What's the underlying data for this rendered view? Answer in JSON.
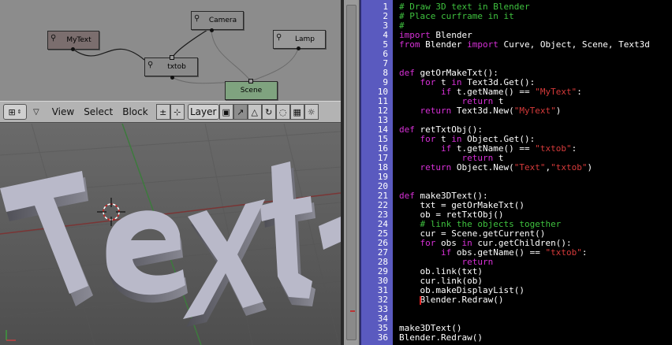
{
  "graph": {
    "nodes": [
      {
        "id": "camera",
        "label": "Camera",
        "glyph": "⚲",
        "fill": "#8e8e8e"
      },
      {
        "id": "mytext",
        "label": "MyText",
        "glyph": "⚲",
        "fill": "#7b6e6e"
      },
      {
        "id": "lamp",
        "label": "Lamp",
        "glyph": "⚲",
        "fill": "#9a9a9a"
      },
      {
        "id": "txtob",
        "label": "txtob",
        "glyph": "⚲",
        "fill": "#8a8a8a"
      },
      {
        "id": "scene",
        "label": "Scene",
        "glyph": "",
        "fill": "#7fa37f"
      }
    ]
  },
  "header": {
    "editor_type_glyph": "⊞",
    "menu": [
      "View",
      "Select",
      "Block"
    ],
    "layer_label": "Layer",
    "colors": {
      "background": "#b3b3b3"
    }
  },
  "viewport": {
    "text_object": "Text",
    "colors": {
      "text_face": "#b9b9c9",
      "background": "#5c5c5c",
      "grid_red": "#7a3535",
      "grid_green": "#3d7a3d"
    }
  },
  "editor": {
    "colors": {
      "comment": "#3fc23f",
      "keyword": "#d630d6",
      "string": "#d63a3a",
      "gutter": "#5a5abf",
      "bg": "#000000"
    },
    "cursor_line": 32,
    "lines": [
      {
        "n": "1",
        "tokens": [
          [
            "c",
            "# Draw 3D text in Blender"
          ]
        ]
      },
      {
        "n": "2",
        "tokens": [
          [
            "c",
            "# Place curframe in it"
          ]
        ]
      },
      {
        "n": "3",
        "tokens": [
          [
            "c",
            "#"
          ]
        ]
      },
      {
        "n": "4",
        "tokens": [
          [
            "k",
            "import"
          ],
          [
            "n",
            " Blender"
          ]
        ]
      },
      {
        "n": "5",
        "tokens": [
          [
            "k",
            "from"
          ],
          [
            "n",
            " Blender "
          ],
          [
            "k",
            "import"
          ],
          [
            "n",
            " Curve, Object, Scene, Text3d"
          ]
        ]
      },
      {
        "n": "6",
        "tokens": []
      },
      {
        "n": "7",
        "tokens": []
      },
      {
        "n": "8",
        "tokens": [
          [
            "k",
            "def"
          ],
          [
            "n",
            " getOrMakeTxt():"
          ]
        ]
      },
      {
        "n": "9",
        "tokens": [
          [
            "n",
            "    "
          ],
          [
            "k",
            "for"
          ],
          [
            "n",
            " t "
          ],
          [
            "k",
            "in"
          ],
          [
            "n",
            " Text3d.Get():"
          ]
        ]
      },
      {
        "n": "10",
        "tokens": [
          [
            "n",
            "        "
          ],
          [
            "k",
            "if"
          ],
          [
            "n",
            " t.getName() == "
          ],
          [
            "s",
            "\"MyText\""
          ],
          [
            "n",
            ":"
          ]
        ]
      },
      {
        "n": "11",
        "tokens": [
          [
            "n",
            "            "
          ],
          [
            "k",
            "return"
          ],
          [
            "n",
            " t"
          ]
        ]
      },
      {
        "n": "12",
        "tokens": [
          [
            "n",
            "    "
          ],
          [
            "k",
            "return"
          ],
          [
            "n",
            " Text3d.New("
          ],
          [
            "s",
            "\"MyText\""
          ],
          [
            "n",
            ")"
          ]
        ]
      },
      {
        "n": "13",
        "tokens": []
      },
      {
        "n": "14",
        "tokens": [
          [
            "k",
            "def"
          ],
          [
            "n",
            " retTxtObj():"
          ]
        ]
      },
      {
        "n": "15",
        "tokens": [
          [
            "n",
            "    "
          ],
          [
            "k",
            "for"
          ],
          [
            "n",
            " t "
          ],
          [
            "k",
            "in"
          ],
          [
            "n",
            " Object.Get():"
          ]
        ]
      },
      {
        "n": "16",
        "tokens": [
          [
            "n",
            "        "
          ],
          [
            "k",
            "if"
          ],
          [
            "n",
            " t.getName() == "
          ],
          [
            "s",
            "\"txtob\""
          ],
          [
            "n",
            ":"
          ]
        ]
      },
      {
        "n": "17",
        "tokens": [
          [
            "n",
            "            "
          ],
          [
            "k",
            "return"
          ],
          [
            "n",
            " t"
          ]
        ]
      },
      {
        "n": "18",
        "tokens": [
          [
            "n",
            "    "
          ],
          [
            "k",
            "return"
          ],
          [
            "n",
            " Object.New("
          ],
          [
            "s",
            "\"Text\""
          ],
          [
            "n",
            ","
          ],
          [
            "s",
            "\"txtob\""
          ],
          [
            "n",
            ")"
          ]
        ]
      },
      {
        "n": "19",
        "tokens": []
      },
      {
        "n": "20",
        "tokens": []
      },
      {
        "n": "21",
        "tokens": [
          [
            "k",
            "def"
          ],
          [
            "n",
            " make3DText():"
          ]
        ]
      },
      {
        "n": "22",
        "tokens": [
          [
            "n",
            "    txt = getOrMakeTxt()"
          ]
        ]
      },
      {
        "n": "23",
        "tokens": [
          [
            "n",
            "    ob = retTxtObj()"
          ]
        ]
      },
      {
        "n": "24",
        "tokens": [
          [
            "n",
            "    "
          ],
          [
            "c",
            "# link the objects together"
          ]
        ]
      },
      {
        "n": "25",
        "tokens": [
          [
            "n",
            "    cur = Scene.getCurrent()"
          ]
        ]
      },
      {
        "n": "26",
        "tokens": [
          [
            "n",
            "    "
          ],
          [
            "k",
            "for"
          ],
          [
            "n",
            " obs "
          ],
          [
            "k",
            "in"
          ],
          [
            "n",
            " cur.getChildren():"
          ]
        ]
      },
      {
        "n": "27",
        "tokens": [
          [
            "n",
            "        "
          ],
          [
            "k",
            "if"
          ],
          [
            "n",
            " obs.getName() == "
          ],
          [
            "s",
            "\"txtob\""
          ],
          [
            "n",
            ":"
          ]
        ]
      },
      {
        "n": "28",
        "tokens": [
          [
            "n",
            "            "
          ],
          [
            "k",
            "return"
          ]
        ]
      },
      {
        "n": "29",
        "tokens": [
          [
            "n",
            "    ob.link(txt)"
          ]
        ]
      },
      {
        "n": "30",
        "tokens": [
          [
            "n",
            "    cur.link(ob)"
          ]
        ]
      },
      {
        "n": "31",
        "tokens": [
          [
            "n",
            "    ob.makeDisplayList()"
          ]
        ]
      },
      {
        "n": "32",
        "tokens": [
          [
            "n",
            "    Blender.Redraw()"
          ]
        ]
      },
      {
        "n": "33",
        "tokens": []
      },
      {
        "n": "34",
        "tokens": []
      },
      {
        "n": "35",
        "tokens": [
          [
            "n",
            "make3DText()"
          ]
        ]
      },
      {
        "n": "36",
        "tokens": [
          [
            "n",
            "Blender.Redraw()"
          ]
        ]
      }
    ]
  }
}
